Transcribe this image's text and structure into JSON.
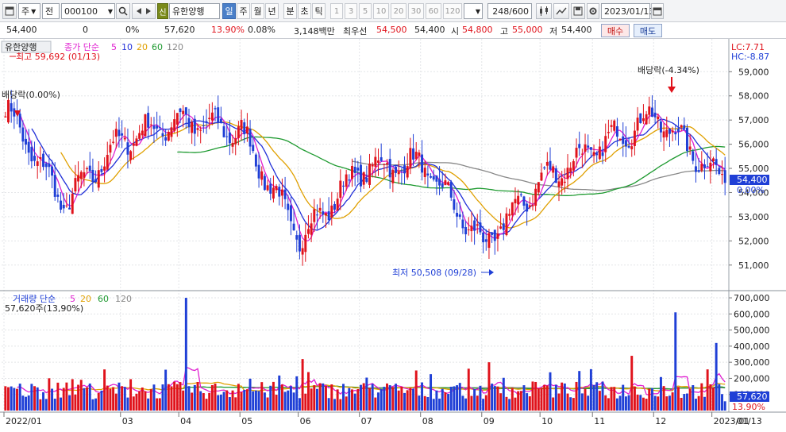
{
  "toolbar": {
    "type_select": "주",
    "prefix_label": "전",
    "code_value": "000100",
    "stock_name": "유한양행",
    "credit_badge": "신",
    "period_tabs": [
      "일",
      "주",
      "월",
      "년",
      "분",
      "초",
      "틱"
    ],
    "active_tab": "일",
    "interval_buttons": [
      "1",
      "3",
      "5",
      "10",
      "20",
      "30",
      "60",
      "120"
    ],
    "count_value": "248/600",
    "date_value": "2023/01/13"
  },
  "quote": {
    "price": "54,400",
    "change": "0",
    "change_pct": "0%",
    "prev_volume": "57,620",
    "volume_ratio": "13.90%",
    "turnover_ratio": "0.08%",
    "amount": "3,148백만",
    "preferred_label": "최우선",
    "ask": "54,500",
    "bid": "54,400",
    "open_label": "시",
    "open": "54,800",
    "high_label": "고",
    "high": "55,000",
    "low_label": "저",
    "low": "54,400",
    "buy_label": "매수",
    "sell_label": "매도"
  },
  "colors": {
    "up": "#e0121b",
    "down": "#1f3fd6",
    "ma5": "#e020d0",
    "ma10": "#2230d8",
    "ma20": "#e0a000",
    "ma60": "#1e9a30",
    "ma120": "#888888"
  },
  "price_panel": {
    "name": "유한양행",
    "legend_prefix": "종가 단순",
    "ma_periods": [
      "5",
      "10",
      "20",
      "60",
      "120"
    ],
    "high_annotation": "최고 59,692 (01/13)",
    "ex_div_left": "배당락(0.00%)",
    "ex_div_right": "배당락(-4.34%)",
    "low_annotation": "최저 50,508 (09/28)",
    "lc_label": "LC:7.71",
    "hc_label": "HC:-8.87",
    "y_ticks": [
      "59,000",
      "58,000",
      "57,000",
      "56,000",
      "55,000",
      "54,000",
      "53,000",
      "52,000",
      "51,000"
    ],
    "current_label": "54,400",
    "current_pct": "0.00%"
  },
  "volume_panel": {
    "legend_prefix": "거래량 단순",
    "ma_periods": [
      "5",
      "20",
      "60",
      "120"
    ],
    "volume_label": "57,620주(13,90%)",
    "y_ticks": [
      "700,000",
      "600,000",
      "500,000",
      "400,000",
      "300,000",
      "200,000",
      "100,000"
    ],
    "current_label": "57,620",
    "current_pct": "13.90%"
  },
  "x_axis": {
    "labels": [
      "2022/01",
      "03",
      "04",
      "05",
      "06",
      "07",
      "08",
      "09",
      "10",
      "11",
      "12",
      "2023/01"
    ],
    "right_label": "01/13"
  },
  "chart_data": {
    "type": "candlestick",
    "period": "daily",
    "count": 248,
    "x_axis_labels": [
      "2022/01",
      "03",
      "04",
      "05",
      "06",
      "07",
      "08",
      "09",
      "10",
      "11",
      "12",
      "2023/01"
    ],
    "price_y_range": [
      50500,
      59700
    ],
    "volume_y_range": [
      0,
      720000
    ],
    "price_anchors": [
      {
        "date": "2022/01",
        "close": 57500
      },
      {
        "date": "2022/02",
        "close": 53500
      },
      {
        "date": "2022/03",
        "close": 56200
      },
      {
        "date": "2022/04",
        "close": 57000
      },
      {
        "date": "2022/05",
        "close": 56500
      },
      {
        "date": "2022/06",
        "close": 52100
      },
      {
        "date": "2022/07",
        "close": 55000
      },
      {
        "date": "2022/08",
        "close": 55200
      },
      {
        "date": "2022/09",
        "close": 51800
      },
      {
        "date": "2022/10",
        "close": 54500
      },
      {
        "date": "2022/11",
        "close": 55800
      },
      {
        "date": "2022/12",
        "close": 57200
      },
      {
        "date": "2023/01/13",
        "close": 54400
      }
    ],
    "high": 59692,
    "low": 50508,
    "last_close": 54400,
    "last_volume": 57620,
    "volume_spikes": [
      {
        "date": "2022/04",
        "volume": 700000
      },
      {
        "date": "2022/12",
        "volume": 610000
      },
      {
        "date": "2023/01",
        "volume": 420000
      }
    ]
  }
}
